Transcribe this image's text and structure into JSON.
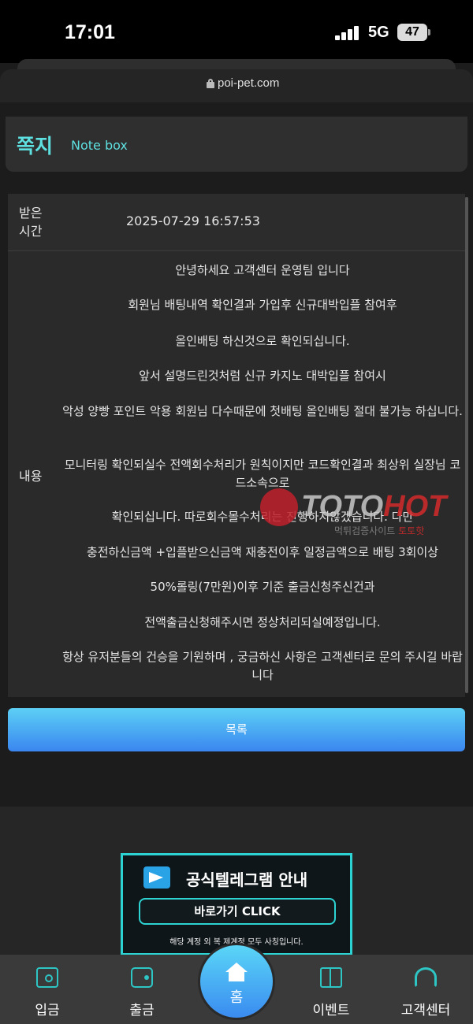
{
  "status_bar": {
    "time": "17:01",
    "network": "5G",
    "battery": "47"
  },
  "browser": {
    "url": "poi-pet.com"
  },
  "header": {
    "title": "쪽지",
    "subtitle": "Note box"
  },
  "message": {
    "time_label": "받은\n시간",
    "time_value": "2025-07-29 16:57:53",
    "content_label": "내용",
    "lines": [
      "안녕하세요 고객센터 운영팀 입니다",
      "회원님 배팅내역 확인결과 가입후 신규대박입플 참여후",
      "올인배팅 하신것으로 확인되십니다.",
      "앞서 설명드린것처럼 신규 카지노 대박입플 참여시",
      "악성 양빵 포인트 악용 회원님 다수때문에 첫배팅 올인배팅 절대 불가능 하십니다.",
      "모니터링 확인되실수 전액회수처리가 원칙이지만 코드확인결과 최상위 실장님 코드소속으로",
      "확인되십니다. 따로회수몰수처리는 진행하지않겠습니다. 다만",
      "충전하신금액 +입플받으신금액 재충전이후 일정금액으로 배팅 3회이상",
      "50%롤링(7만원)이후 기준 출금신청주신건과",
      "전액출금신청해주시면 정상처리되실예정입니다.",
      "항상 유저분들의 건승을 기원하며 , 궁금하신 사항은 고객센터로 문의 주시길 바랍니다"
    ]
  },
  "list_button": {
    "label": "목록"
  },
  "telegram": {
    "title": "공식텔레그램 안내",
    "button": "바로가기 CLICK",
    "note": "해당 계정 외 복 제계정 모두 사칭입니다."
  },
  "watermark": {
    "brand_a": "TOTO",
    "brand_b": "HOT",
    "sub": "먹튀검증사이트",
    "sub_red": "토토핫"
  },
  "nav": {
    "deposit": "입금",
    "withdraw": "출금",
    "home": "홈",
    "event": "이벤트",
    "support": "고객센터"
  },
  "colors": {
    "accent": "#5fe0e0",
    "button_top": "#5dd0f5",
    "button_bottom": "#3a86f0"
  }
}
